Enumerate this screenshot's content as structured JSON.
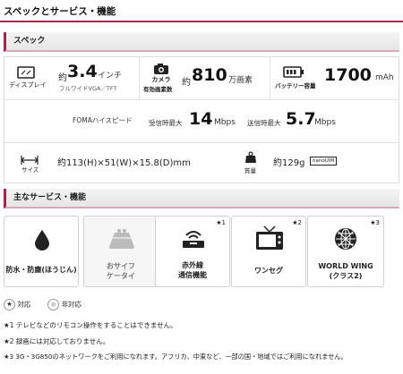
{
  "page_title": "スペックとサービス・機能",
  "spec_section": {
    "title": "スペック"
  },
  "display": {
    "label": "ディスプレイ",
    "prefix": "約",
    "size": "3.4",
    "unit": "インチ",
    "detail": "フルワイドVGA／TFT"
  },
  "camera": {
    "label1": "カメラ",
    "label2": "有効画素数",
    "prefix": "約",
    "value": "810",
    "unit": "万画素"
  },
  "battery": {
    "label": "バッテリー容量",
    "value": "1700",
    "unit": "mAh"
  },
  "foma": {
    "label": "FOMAハイスピード",
    "down_label": "受信時最大",
    "down_value": "14",
    "down_unit": "Mbps",
    "up_label": "送信時最大",
    "up_value": "5.7",
    "up_unit": "Mbps"
  },
  "size": {
    "label": "サイズ",
    "value": "約113(H)×51(W)×15.8(D)mm"
  },
  "weight": {
    "label": "質量",
    "value": "約129g",
    "sim": "nanoUIM"
  },
  "services_section": {
    "title": "主なサービス・機能"
  },
  "services": [
    {
      "line1": "防水・防塵(ほうじん)",
      "line2": "",
      "icon": "water-drop-icon",
      "supported": true,
      "mark": ""
    },
    {
      "line1": "おサイフ",
      "line2": "ケータイ",
      "icon": "wallet-icon",
      "supported": false,
      "mark": ""
    },
    {
      "line1": "赤外線",
      "line2": "通信機能",
      "icon": "infrared-icon",
      "supported": true,
      "mark": "★1"
    },
    {
      "line1": "ワンセグ",
      "line2": "",
      "icon": "tv-icon",
      "supported": true,
      "mark": "★2"
    },
    {
      "line1": "WORLD WING",
      "line2": "(クラス2)",
      "icon": "globe-icon",
      "supported": true,
      "mark": "★3"
    }
  ],
  "legend": {
    "supported_label": "対応",
    "unsupported_label": "非対応",
    "supported_symbol": "★",
    "unsupported_symbol": "●"
  },
  "notes": [
    "★1 テレビなどのリモコン操作をすることはできません。",
    "★2 録画には対応しておりません。",
    "★3 3G・3G850のネットワークをご利用になれます。アフリカ、中東など、一部の国・地域ではご利用になれません。"
  ],
  "colors": {
    "accent": "#a3284a",
    "icon": "#222222",
    "disabled_icon": "#bbbbbb"
  }
}
